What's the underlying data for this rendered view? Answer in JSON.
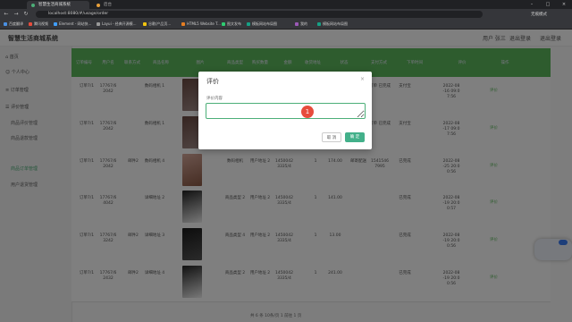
{
  "browser": {
    "tabs": [
      {
        "label": "智慧生活商城系统"
      },
      {
        "label": "后台"
      }
    ],
    "url": "localhost:8080/#/usage/order",
    "user": "无痕模式",
    "bookmarks": [
      "百度翻译",
      "腾讯视频",
      "Element - 网站快...",
      "Layui - 经典开源模...",
      "谷歌/产品页...",
      "HTML5 Website T...",
      "图文发布",
      "模板网站布局图",
      "我的",
      "模板网站布局图"
    ]
  },
  "app": {
    "title": "智慧生活商城系统",
    "header_links": [
      "用户 张三",
      "退出登录",
      "退出登录"
    ],
    "sidebar": {
      "items": [
        "首页",
        "个人中心",
        "订单管理",
        "评价管理"
      ],
      "subitems": [
        "商品评价管理",
        "商品退款管理",
        "商品订单管理",
        "用户退货管理"
      ]
    },
    "table": {
      "headers": [
        "订单编号",
        "用户名",
        "联系方式",
        "商品名称",
        "图片",
        "商品类型",
        "购买数量",
        "金额",
        "收货地址",
        "状态",
        "支付方式",
        "下单时间",
        "评价",
        "操作"
      ],
      "rows": [
        {
          "id": "订单7/1",
          "user": "17767/6 2042",
          "phone": "",
          "name": "数码相机 1",
          "type": "",
          "qty": "",
          "amount": "",
          "addr": "",
          "num": "",
          "pay": "",
          "status": "订单 已完成",
          "way": "支付宝",
          "time": "2022-08 -16 09:0 7:56",
          "action": "评价"
        },
        {
          "id": "订单7/1",
          "user": "17767/6 2042",
          "phone": "",
          "name": "数码相机 1",
          "type": "",
          "qty": "",
          "amount": "",
          "addr": "",
          "num": "",
          "pay": "",
          "status": "订单 已完成",
          "way": "支付宝",
          "time": "2022-08 -17 09:0 7:56",
          "action": "评价"
        },
        {
          "id": "订单7/1",
          "user": "17767/6 2042",
          "phone": "邮件2",
          "name": "数码相机 4",
          "type": "数码相机",
          "qty": "用户地址 2",
          "amount": "1450042 3335/4",
          "addr": "1",
          "num": "174.00",
          "pay": "邮寄配送",
          "status": "1541546 7995",
          "way": "已完成",
          "time": "2022-08 -25 20:0 0:56",
          "action": "评价"
        },
        {
          "id": "订单7/1",
          "user": "17767/6 4042",
          "phone": "",
          "name": "详细地址 2",
          "type": "商品类型 2",
          "qty": "用户地址 2",
          "amount": "1450042 3335/4",
          "addr": "1",
          "num": "141.00",
          "pay": "",
          "status": "",
          "way": "已完成",
          "time": "2022-08 -19 20:0 0:57",
          "action": "评价"
        },
        {
          "id": "订单7/1",
          "user": "17767/6 3242",
          "phone": "邮件2",
          "name": "详细地址 3",
          "type": "商品类型 4",
          "qty": "用户地址 2",
          "amount": "1450042 3335/4",
          "addr": "1",
          "num": "13.00",
          "pay": "",
          "status": "",
          "way": "已完成",
          "time": "2022-08 -19 20:0 0:56",
          "action": "评价"
        },
        {
          "id": "订单7/1",
          "user": "17767/6 2432",
          "phone": "邮件2",
          "name": "详细地址 4",
          "type": "商品类型 2",
          "qty": "用户地址 2",
          "amount": "1450042 3335/4",
          "addr": "1",
          "num": "241.00",
          "pay": "",
          "status": "",
          "way": "已完成",
          "time": "2022-08 -19 20:0 0:56",
          "action": "评价"
        }
      ],
      "pager": "共 6 条    10条/页    1    前往 1 页"
    }
  },
  "dialog": {
    "title": "评价",
    "close": "×",
    "label": "评价内容",
    "input_value": "",
    "marker": "1",
    "cancel": "取 消",
    "ok": "确 定"
  },
  "colors": {
    "accent": "#5cb85c",
    "primary_button": "#43b08a",
    "marker": "#e74c3c"
  }
}
